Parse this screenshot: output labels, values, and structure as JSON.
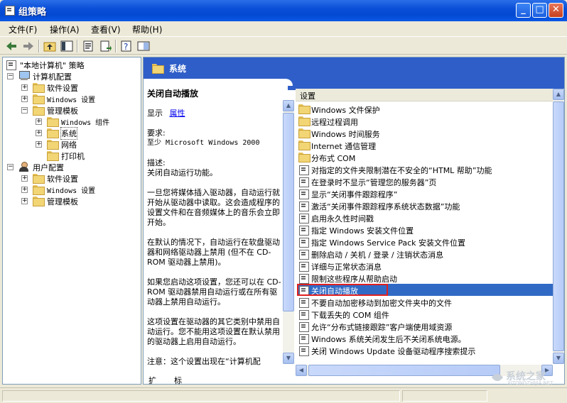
{
  "window": {
    "title": "组策略",
    "buttons": {
      "minimize": "_",
      "maximize": "□",
      "close": "✕"
    }
  },
  "menu": [
    {
      "label": "文件(F)"
    },
    {
      "label": "操作(A)"
    },
    {
      "label": "查看(V)"
    },
    {
      "label": "帮助(H)"
    }
  ],
  "toolbar": {
    "icons": [
      "back-arrow-icon",
      "forward-arrow-icon",
      "up-folder-icon",
      "show-tree-icon",
      "properties-icon",
      "export-list-icon",
      "help-icon",
      "extended-view-icon"
    ]
  },
  "tree": {
    "root": "\"本地计算机\" 策略",
    "computer_config": "计算机配置",
    "software_settings": "软件设置",
    "windows_settings": "Windows 设置",
    "admin_templates": "管理模板",
    "windows_components": "Windows 组件",
    "system": "系统",
    "network": "网络",
    "printers": "打印机",
    "user_config": "用户配置",
    "user_software_settings": "软件设置",
    "user_windows_settings": "Windows 设置",
    "user_admin_templates": "管理模板"
  },
  "header": {
    "title": "系统"
  },
  "description": {
    "title": "关闭自动播放",
    "show_label": "显示",
    "properties_link": "属性",
    "requirements_label": "要求:",
    "requirements_value": "至少 Microsoft Windows 2000",
    "desc_label": "描述:",
    "desc_value": "关闭自动运行功能。",
    "para1": "一旦您将媒体插入驱动器，自动运行就开始从驱动器中读取。这会造成程序的设置文件和在音频媒体上的音乐会立即开始。",
    "para2": "在默认的情况下，自动运行在软盘驱动器和网络驱动器上禁用 (但不在 CD-ROM 驱动器上禁用)。",
    "para3": "如果您启动这项设置，您还可以在 CD-ROM 驱动器禁用自动运行或在所有驱动器上禁用自动运行。",
    "para4": "这项设置在驱动器的其它类别中禁用自动运行。您不能用这项设置在默认禁用的驱动器上启用自动运行。",
    "para5": "注意：这个设置出现在“计算机配"
  },
  "settings": {
    "column_header": "设置",
    "items": [
      {
        "label": "Windows 文件保护",
        "icon": "folder-icon"
      },
      {
        "label": "远程过程调用",
        "icon": "folder-icon"
      },
      {
        "label": "Windows 时间服务",
        "icon": "folder-icon"
      },
      {
        "label": "Internet 通信管理",
        "icon": "folder-icon"
      },
      {
        "label": "分布式 COM",
        "icon": "folder-icon"
      },
      {
        "label": "对指定的文件夹限制潜在不安全的“HTML 帮助”功能",
        "icon": "policy-icon"
      },
      {
        "label": "在登录时不显示“管理您的服务器”页",
        "icon": "policy-icon"
      },
      {
        "label": "显示“关闭事件跟踪程序”",
        "icon": "policy-icon"
      },
      {
        "label": "激活“关闭事件跟踪程序系统状态数据”功能",
        "icon": "policy-icon"
      },
      {
        "label": "启用永久性时间戳",
        "icon": "policy-icon"
      },
      {
        "label": "指定 Windows 安装文件位置",
        "icon": "policy-icon"
      },
      {
        "label": "指定 Windows Service Pack 安装文件位置",
        "icon": "policy-icon"
      },
      {
        "label": "删除启动 / 关机 / 登录 / 注销状态消息",
        "icon": "policy-icon"
      },
      {
        "label": "详细与正常状态消息",
        "icon": "policy-icon"
      },
      {
        "label": "限制这些程序从帮助启动",
        "icon": "policy-icon"
      },
      {
        "label": "关闭自动播放",
        "icon": "policy-icon",
        "selected": true
      },
      {
        "label": "不要自动加密移动到加密文件夹中的文件",
        "icon": "policy-icon"
      },
      {
        "label": "下载丢失的 COM 组件",
        "icon": "policy-icon"
      },
      {
        "label": "允许“分布式链接跟踪”客户端使用域资源",
        "icon": "policy-icon"
      },
      {
        "label": "Windows 系统关闭发生后不关闭系统电源。",
        "icon": "policy-icon"
      },
      {
        "label": "关闭 Windows Update 设备驱动程序搜索提示",
        "icon": "policy-icon"
      }
    ]
  },
  "tabs": [
    {
      "label": "扩展"
    },
    {
      "label": "标准"
    }
  ],
  "watermark": {
    "text": "系统之家",
    "sub": "XITONGZHIJIA.NET"
  },
  "colors": {
    "header_blue": "#2f5ec8",
    "selection": "#316ac5",
    "highlight_box": "#e02020"
  }
}
